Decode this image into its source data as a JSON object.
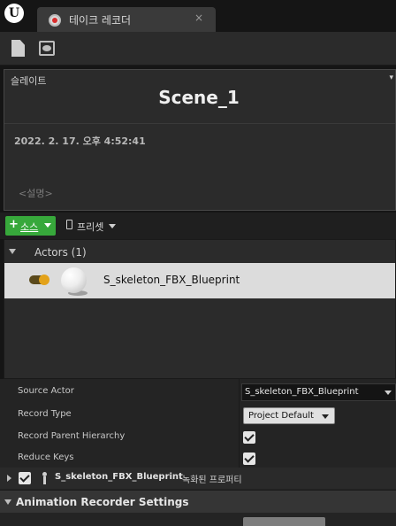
{
  "window": {
    "logo": "U",
    "tab_title": "테이크 레코더",
    "tab_close": "×"
  },
  "toolbar": {
    "icons": [
      "new-document-icon",
      "recording-view-icon"
    ]
  },
  "slate": {
    "label": "슬레이트",
    "scene": "Scene_1",
    "timestamp": "2022. 2. 17. 오후 4:52:41",
    "description_placeholder": "<설명>"
  },
  "sources_bar": {
    "source_button": "소스",
    "preset_button": "프리셋"
  },
  "actors": {
    "header": "Actors (1)",
    "items": [
      {
        "name": "S_skeleton_FBX_Blueprint",
        "enabled": true
      }
    ]
  },
  "details": {
    "source_actor": {
      "label": "Source Actor",
      "value": "S_skeleton_FBX_Blueprint"
    },
    "record_type": {
      "label": "Record Type",
      "value": "Project Default"
    },
    "record_parent_hierarchy": {
      "label": "Record Parent Hierarchy",
      "checked": true
    },
    "reduce_keys": {
      "label": "Reduce Keys",
      "checked": true
    },
    "recorded_properties": {
      "actor": "S_skeleton_FBX_Blueprint",
      "suffix": "녹화된 프로퍼티",
      "checked": true
    },
    "section": "Animation Recorder Settings"
  },
  "colors": {
    "accent_green": "#37a83b",
    "record_red": "#d92c2c",
    "toggle_orange": "#e3a21a",
    "selection_row": "#dcdcdc"
  }
}
